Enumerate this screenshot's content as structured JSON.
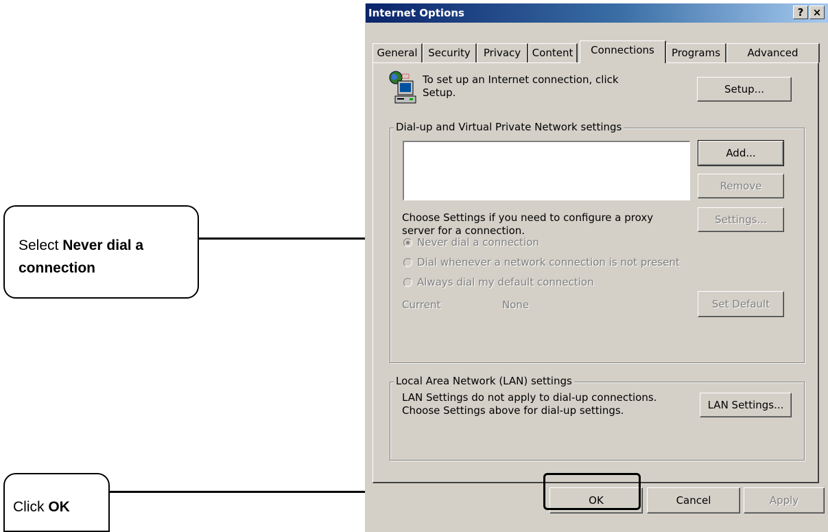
{
  "callouts": {
    "never_dial": {
      "prefix": "Select ",
      "bold": "Never dial a",
      "bold2": "connection"
    },
    "click_ok": {
      "prefix": "Click ",
      "bold": "OK"
    }
  },
  "dialog": {
    "title": "Internet Options",
    "help_btn": "?",
    "close_btn": "×",
    "tabs": [
      "General",
      "Security",
      "Privacy",
      "Content",
      "Connections",
      "Programs",
      "Advanced"
    ],
    "active_tab": "Connections",
    "setup_text_1": "To set up an Internet connection, click",
    "setup_text_2": "Setup.",
    "setup_button": "Setup...",
    "dialup_group": "Dial-up and Virtual Private Network settings",
    "add_button": "Add...",
    "remove_button": "Remove",
    "settings_text_1": "Choose Settings if you need to configure a proxy",
    "settings_text_2": "server for a connection.",
    "settings_button": "Settings...",
    "radio_never": "Never dial a connection",
    "radio_whenever": "Dial whenever a network connection is not present",
    "radio_always": "Always dial my default connection",
    "current_label": "Current",
    "current_value": "None",
    "set_default_button": "Set Default",
    "lan_group": "Local Area Network (LAN) settings",
    "lan_text_1": "LAN Settings do not apply to dial-up connections.",
    "lan_text_2": "Choose Settings above for dial-up settings.",
    "lan_button": "LAN Settings...",
    "ok_button": "OK",
    "cancel_button": "Cancel",
    "apply_button": "Apply"
  },
  "colors": {
    "face": "#d4d0c8",
    "titlebar_start": "#0a246a",
    "titlebar_end": "#a6caf0",
    "disabled": "#808080"
  }
}
